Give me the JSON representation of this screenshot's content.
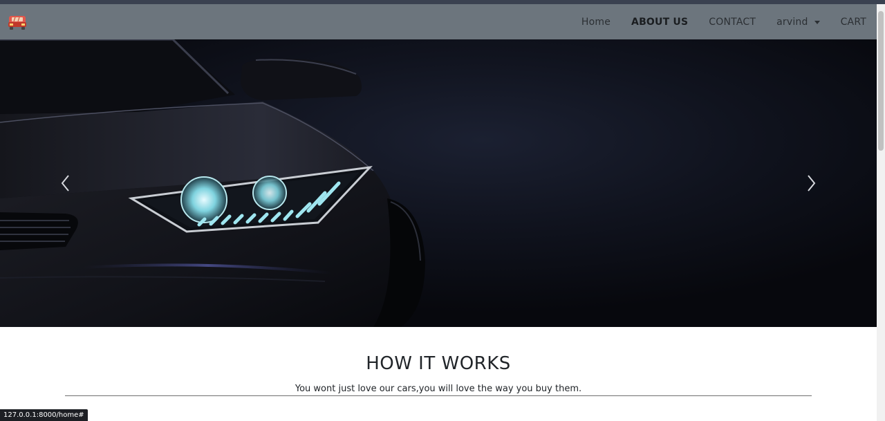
{
  "navbar": {
    "brand_icon": "car-icon",
    "links": {
      "home": "Home",
      "about": "ABOUT US",
      "contact": "CONTACT",
      "user": "arvind",
      "cart": "CART"
    }
  },
  "hero": {
    "prev_icon": "chevron-left-icon",
    "next_icon": "chevron-right-icon"
  },
  "section": {
    "title": "HOW IT WORKS",
    "subtitle": "You wont just love our cars,you will love the way you buy them."
  },
  "status": {
    "url": "127.0.0.1:8000/home#"
  },
  "colors": {
    "navbar_bg": "#6c757d",
    "hero_bg": "#0a0c13",
    "headlight_glow": "#9fe6f0"
  }
}
